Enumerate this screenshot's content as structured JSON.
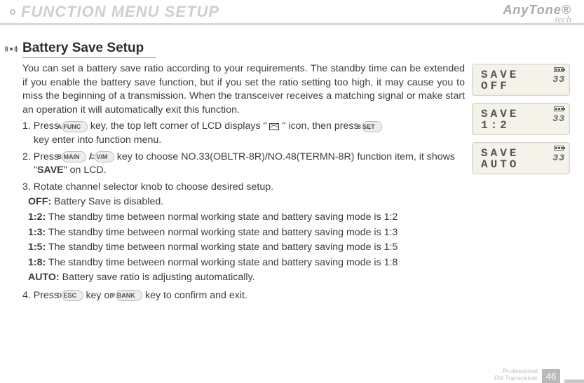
{
  "header": {
    "title": "FUNCTION MENU SETUP"
  },
  "brand": {
    "main": "AnyTone®",
    "sub": "tech"
  },
  "section": {
    "title": "Battery Save Setup",
    "intro": "You can set a battery save ratio according to your requirements. The standby time can be extended if you enable the battery save function, but if you set the ratio setting too high, it may cause you to miss the beginning of a transmission. When the transceiver receives a matching signal or make start an operation it will automatically exit this function."
  },
  "steps": {
    "s1a": "1. Press ",
    "s1b": " key, the top left corner of LCD displays \" ",
    "s1c": " \" icon, then press ",
    "s1d": " key enter into function menu.",
    "s2a": "2. Press ",
    "s2b": " / ",
    "s2c": " key to choose NO.33(OBLTR-8R)/NO.48(TERMN-8R) function item, it shows \"",
    "s2d": "\" on LCD.",
    "s2bold": "SAVE",
    "s3": "3. Rotate channel selector knob to choose desired setup.",
    "s4a": "4. Press ",
    "s4b": " key or ",
    "s4c": " key to confirm and exit."
  },
  "options": {
    "off": {
      "lbl": "OFF:",
      "txt": " Battery Save is disabled."
    },
    "r12": {
      "lbl": "1:2:",
      "txt": " The standby time between normal working state and battery saving mode is 1:2"
    },
    "r13": {
      "lbl": "1:3:",
      "txt": " The standby time between normal working state and battery saving mode is 1:3"
    },
    "r15": {
      "lbl": "1:5:",
      "txt": " The standby time between normal working state and battery saving mode is 1:5"
    },
    "r18": {
      "lbl": "1:8:",
      "txt": " The standby time between normal working state and battery saving mode is 1:8"
    },
    "auto": {
      "lbl": "AUTO:",
      "txt": " Battery save ratio is adjusting automatically."
    }
  },
  "keys": {
    "func": "A FUNC",
    "set": "8 SET",
    "main": "B MAIN",
    "vm": "C V/M",
    "esc": "D ESC",
    "bank": "# BANK"
  },
  "lcd": [
    {
      "l1": "SAVE",
      "l2": " OFF",
      "num": "33"
    },
    {
      "l1": "SAVE",
      "l2": "1:2",
      "num": "33"
    },
    {
      "l1": "SAVE",
      "l2": "AUTO",
      "num": "33"
    }
  ],
  "footer": {
    "l1": "Professional",
    "l2": "FM Transceiver",
    "page": "46"
  }
}
